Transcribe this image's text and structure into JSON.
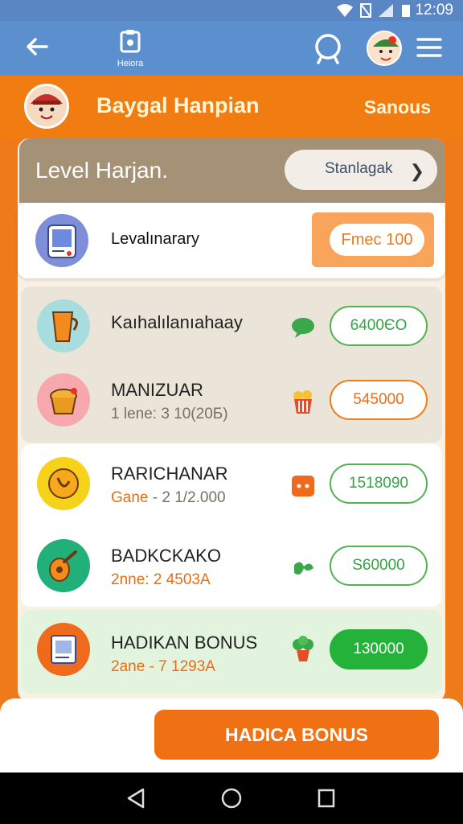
{
  "status": {
    "time": "12:09"
  },
  "appbar": {
    "center_label": "Heiora"
  },
  "header": {
    "title": "Baygal Hanpian",
    "right": "Sanous"
  },
  "level": {
    "title": "Level Harjan.",
    "pill_label": "Stanlagak"
  },
  "level_item": {
    "name": "Levalınarary",
    "button": "Fmec 100"
  },
  "rows": [
    {
      "name": "Kaıhalılanıahaay",
      "sub_key": "",
      "sub_val": "",
      "value": "6400ЄO"
    },
    {
      "name": "MANIZUAR",
      "sub_key": "1 lene:",
      "sub_val": "3 10(20Б)",
      "value": "545000"
    },
    {
      "name": "RARICHANAR",
      "sub_key": "Gane",
      "sub_val": "- 2 1/2.000",
      "value": "1518090"
    },
    {
      "name": "BADKCKAKO",
      "sub_key": "2nne",
      "sub_val": ": 2 4503A",
      "value": "S60000"
    },
    {
      "name": "HADIKAN BONUS",
      "sub_key": "2ane",
      "sub_val": "- 7 1293A",
      "value": "130000"
    }
  ],
  "bottom": {
    "button": "HADICA BONUS"
  },
  "colors": {
    "orange": "#f07c12",
    "blue": "#5b8fcd",
    "green": "#24b23a"
  }
}
